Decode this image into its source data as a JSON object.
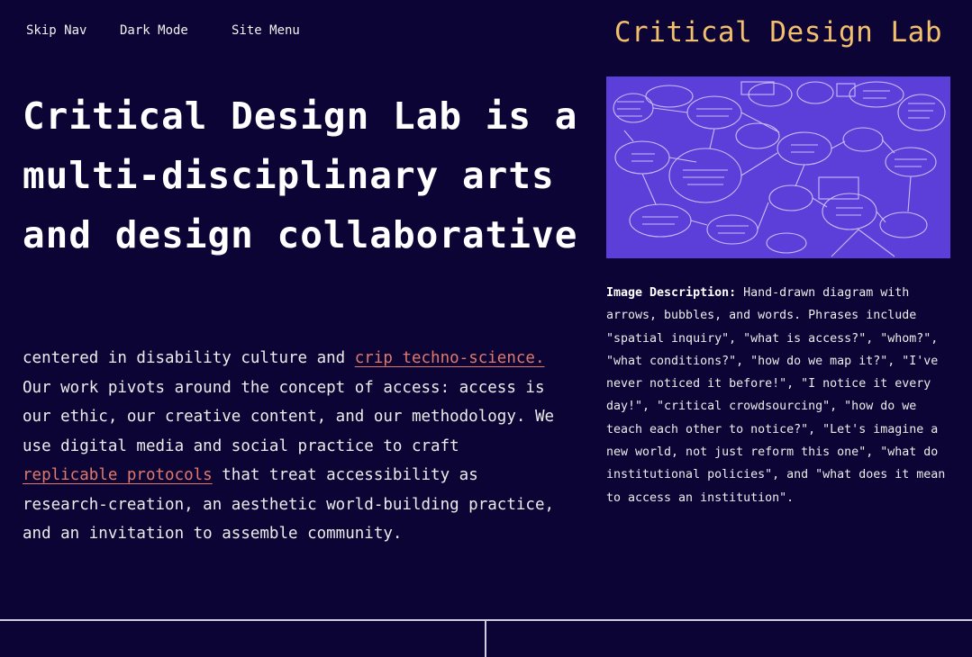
{
  "nav": {
    "skip_nav": "Skip Nav",
    "dark_mode": "Dark Mode",
    "site_menu": "Site Menu"
  },
  "brand": "Critical Design Lab",
  "headline": "Critical Design Lab is a multi-disciplinary arts and design collaborative",
  "intro": {
    "part1": "centered in disability culture and ",
    "link1": "crip techno-science.",
    "part2": " Our work pivots around the concept of access: access is our ethic, our creative content, and our methodology. We use digital media and social practice to craft ",
    "link2": "replicable protocols",
    "part3": " that treat accessibility as research-creation, an aesthetic world-building practice, and an invitation to assemble community."
  },
  "image_description": {
    "label": "Image Description:",
    "text": " Hand-drawn diagram with arrows, bubbles, and words. Phrases include \"spatial inquiry\", \"what is access?\", \"whom?\", \"what conditions?\", \"how do we map it?\", \"I've never noticed it before!\", \"I notice it every day!\", \"critical crowdsourcing\", \"how do we teach each other to notice?\", \"Let's imagine a new world, not just reform this one\", \"what do institutional policies\", and \"what does it mean to access an institution\"."
  },
  "colors": {
    "background": "#0c0434",
    "brand": "#f2c06c",
    "link": "#e0796b",
    "diagram_bg": "#5b3fd8"
  }
}
